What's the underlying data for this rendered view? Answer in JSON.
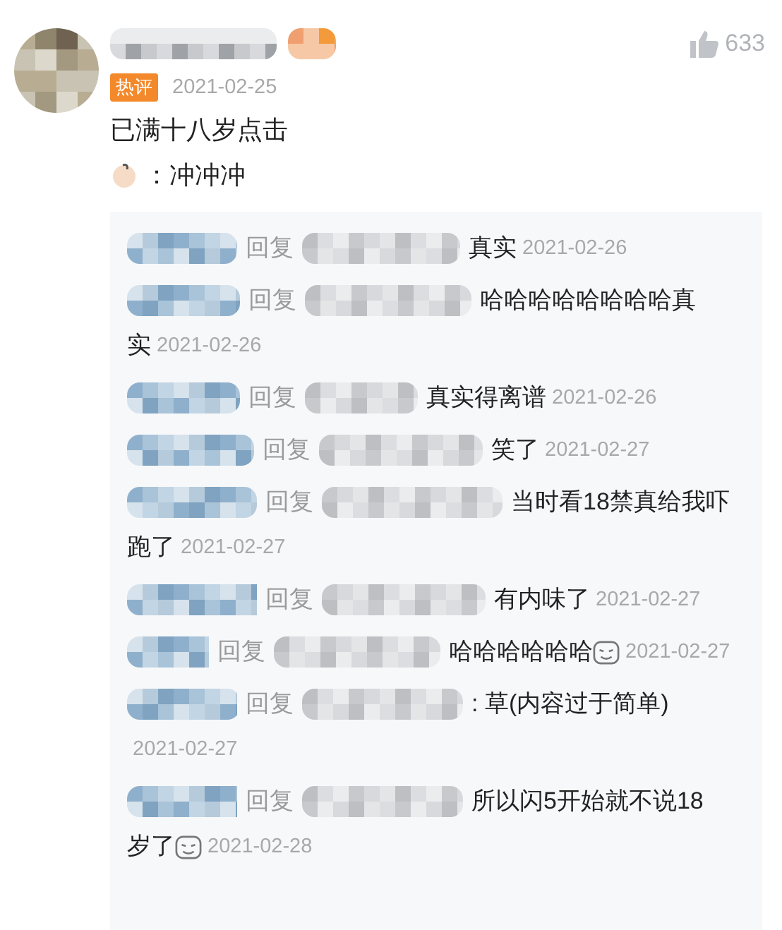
{
  "comment": {
    "tag": "热评",
    "date": "2021-02-25",
    "likes": "633",
    "lines": [
      {
        "emoji": false,
        "text": "已满十八岁点击"
      },
      {
        "emoji": true,
        "text": "：冲冲冲"
      }
    ]
  },
  "replies": [
    {
      "verb": "回复",
      "text": "真实",
      "emoji": false,
      "date": "2021-02-26"
    },
    {
      "verb": "回复",
      "text": "哈哈哈哈哈哈哈哈真",
      "more": "实",
      "emoji": false,
      "date": "2021-02-26"
    },
    {
      "verb": "回复",
      "text": "真实得离谱",
      "emoji": false,
      "date": "2021-02-26"
    },
    {
      "verb": "回复",
      "text": "笑了",
      "emoji": false,
      "date": "2021-02-27"
    },
    {
      "verb": "回复",
      "text": "当时看18禁真给我吓",
      "more": "跑了",
      "emoji": false,
      "date": "2021-02-27"
    },
    {
      "verb": "回复",
      "text": "有内味了",
      "emoji": false,
      "date": "2021-02-27"
    },
    {
      "verb": "回复",
      "text": "哈哈哈哈哈哈",
      "emoji": true,
      "date": "2021-02-27"
    },
    {
      "verb": "回复",
      "text": ": 草(内容过于简单)",
      "emoji": false,
      "date": "2021-02-27"
    },
    {
      "verb": "回复",
      "text": "所以闪5开始就不说18",
      "more": "岁了",
      "emoji": true,
      "date": "2021-02-28"
    }
  ]
}
